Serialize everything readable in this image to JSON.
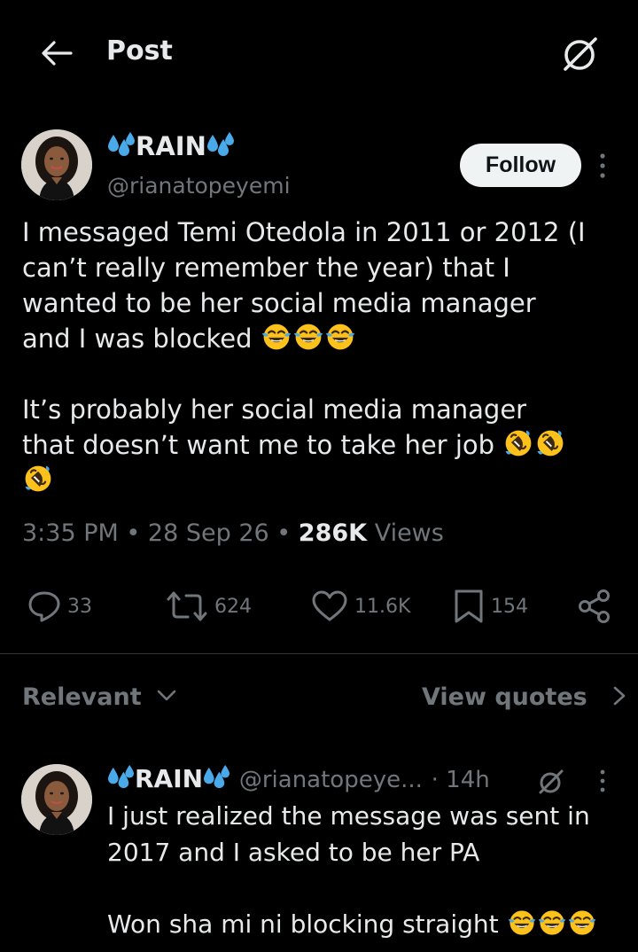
{
  "header": {
    "title": "Post"
  },
  "tweet": {
    "author_name": "RAIN",
    "handle": "@rianatopeyemi",
    "follow_label": "Follow",
    "paragraph1_text": "I messaged Temi Otedola in 2011 or 2012 (I can’t really remember the year) that I wanted to be her social media manager and I was blocked",
    "paragraph1_line1": "I messaged Temi Otedola in 2011 or 2012 (I",
    "paragraph1_line2": "can’t really remember the year) that I",
    "paragraph1_line3": "wanted to be her social media manager",
    "paragraph1_line4": "and I was blocked",
    "paragraph2_line1": "It’s probably her social media manager",
    "paragraph2_line2": "that doesn’t want me to take her job",
    "time": "3:35 PM",
    "date": "28 Sep 26",
    "views_count": "286K",
    "views_label": "Views",
    "stats": {
      "replies": "33",
      "reposts": "624",
      "likes": "11.6K",
      "bookmarks": "154"
    }
  },
  "replies_section": {
    "sort_label": "Relevant",
    "view_quotes_label": "View quotes"
  },
  "reply": {
    "author_name": "RAIN",
    "handle": "@rianatopeye...",
    "time_ago": "· 14h",
    "line1": "I just realized the message was sent in",
    "line2": "2017 and I asked to be her PA",
    "line3": "Won sha mi ni blocking straight"
  },
  "colors": {
    "background": "#000000",
    "text_primary": "#e7e9ea",
    "text_secondary": "#71767b",
    "divider": "#2f3336",
    "follow_bg": "#eff3f4",
    "sweat_emoji": "#4aa9e8",
    "emoji_yellow": "#fcc21b"
  },
  "icons": {
    "back": "arrow-left-icon",
    "grok": "grok-icon",
    "more": "more-vertical-icon",
    "reply": "reply-icon",
    "repost": "repost-icon",
    "like": "heart-icon",
    "bookmark": "bookmark-icon",
    "share": "share-icon",
    "sweat": "sweat-droplets-emoji",
    "joy": "face-with-tears-of-joy-emoji",
    "rofl": "rolling-on-floor-laughing-emoji"
  }
}
